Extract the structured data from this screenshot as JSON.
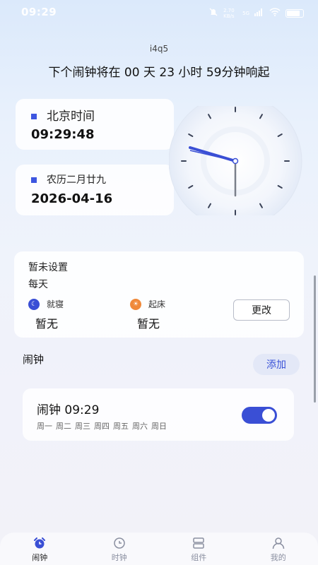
{
  "status": {
    "time": "09:29",
    "net": "2.70 KB/s",
    "signal": "5G",
    "battery_level": 0.75
  },
  "header": {
    "uid": "i4q5",
    "next_alarm": "下个闹钟将在 00 天 23 小时 59分钟响起"
  },
  "beijing": {
    "title": "北京时间",
    "time": "09:29:48"
  },
  "lunar": {
    "title": "农历二月廿九",
    "date": "2026-04-16"
  },
  "sleep": {
    "title": "暂未设置",
    "repeat": "每天",
    "bed_label": "就寝",
    "bed_value": "暂无",
    "wake_label": "起床",
    "wake_value": "暂无",
    "edit_label": "更改",
    "bed_icon": "moon-icon",
    "wake_icon": "sunrise-icon"
  },
  "alarms": {
    "section_title": "闹钟",
    "add_label": "添加",
    "items": [
      {
        "name": "闹钟 09:29",
        "days": [
          "周一",
          "周二",
          "周三",
          "周四",
          "周五",
          "周六",
          "周日"
        ],
        "enabled": true
      }
    ]
  },
  "nav": {
    "items": [
      {
        "label": "闹钟",
        "icon": "alarm-clock-icon",
        "active": true
      },
      {
        "label": "时钟",
        "icon": "clock-icon",
        "active": false
      },
      {
        "label": "组件",
        "icon": "widget-icon",
        "active": false
      },
      {
        "label": "我的",
        "icon": "user-icon",
        "active": false
      }
    ]
  },
  "colors": {
    "accent": "#3a4fd5",
    "orange": "#f0893a"
  }
}
